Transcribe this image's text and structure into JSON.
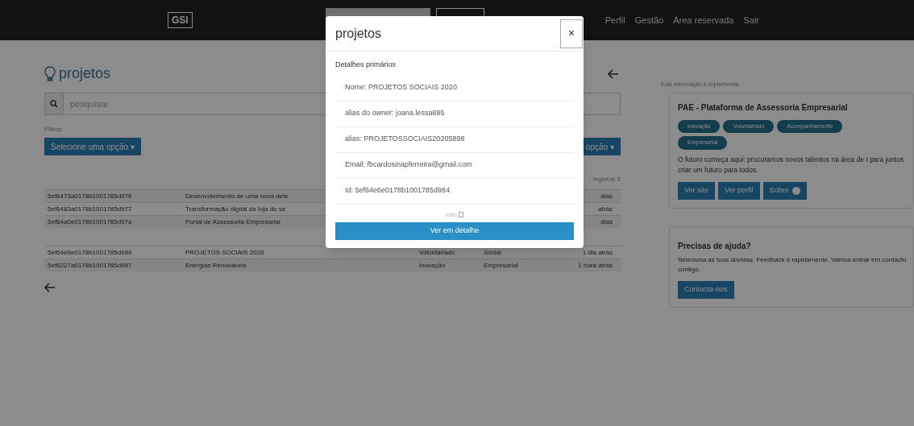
{
  "navbar": {
    "logo": "GSI",
    "links": [
      "Perfil",
      "Gestão",
      "Área reservada",
      "Sair"
    ]
  },
  "page": {
    "title": "projetos",
    "search": {
      "placeholder": "pesquisar"
    },
    "filter_label": "Filtros",
    "filter_button": "Selecione uma opção ▾",
    "second_button_fragment": "opção ▾",
    "count": "registos 5"
  },
  "table": {
    "rows": [
      {
        "id": "5ef6473a0178b1001785d976",
        "name": "Desenvolvimento de uma nova dete",
        "cells": [],
        "last": "dias"
      },
      {
        "id": "5ef6483a0178b1001785d977",
        "name": "Transformação digital da loja do se",
        "cells": [],
        "last": "atrás"
      },
      {
        "id": "5ef64a0e0178b1001785d97a",
        "name": "Portal de Assessoria Empresarial",
        "cells": [],
        "last": "dias"
      },
      {
        "id": "5ef64e6e0178b1001785d984",
        "name": "PROJETOS SOCIAIS 2020",
        "cells": [
          "Voluntariado",
          "Social"
        ],
        "last": "1 dia atrás"
      },
      {
        "id": "5ef6227a0178b1001785d987",
        "name": "Energias Renováveis",
        "cells": [
          "Inovação",
          "Empresarial"
        ],
        "last": "1 hora atrás"
      }
    ]
  },
  "sidebar": {
    "note": "Esta informação é suplementar",
    "card": {
      "title": "PAE - Plataforma de Assessoria Empresarial",
      "tags": [
        "Inovação",
        "Voluntariado",
        "Acompanhamento",
        "Empresarial"
      ],
      "text": "O futuro começa aqui: procuramos novos talentos na área de I para juntos criar um futuro para todos.",
      "buttons": [
        {
          "label": "Ver site",
          "kind": "plain"
        },
        {
          "label": "Ver perfil",
          "kind": "plain"
        },
        {
          "label": "Sobre",
          "kind": "arrow"
        }
      ]
    },
    "help": {
      "title": "Precisas de ajuda?",
      "text": "Seleciona as tuas dúvidas. Feedback é rapidamente. Vamos entrar em contacto contigo.",
      "button": "Contacta-nos"
    }
  },
  "modal": {
    "title": "projetos",
    "close": "×",
    "section": "Detalhes primários",
    "items": [
      "Nome: PROJETOS SOCIAIS 2020",
      "alias do owner: joana.lessa685",
      "alias: PROJETOSSOCIAIS20205898",
      "Email: fbcardosinapferreira@gmail.com",
      "Id: 5ef64e6e0178b1001785d984"
    ],
    "more": "mais",
    "button": "Ver em detalhe"
  }
}
